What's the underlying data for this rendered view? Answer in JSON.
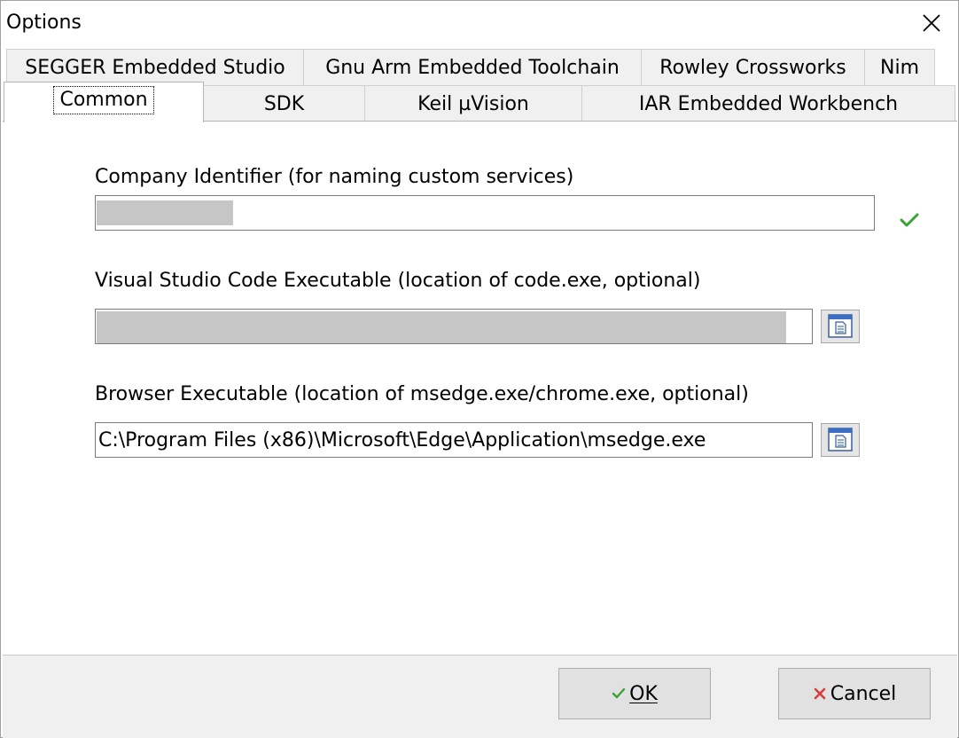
{
  "window": {
    "title": "Options"
  },
  "tabs": {
    "row_top": [
      {
        "label": "SEGGER Embedded Studio"
      },
      {
        "label": "Gnu Arm Embedded Toolchain"
      },
      {
        "label": "Rowley Crossworks"
      },
      {
        "label": "Nim"
      }
    ],
    "row_bottom": [
      {
        "label": "Common",
        "selected": true
      },
      {
        "label": "SDK"
      },
      {
        "label": "Keil µVision"
      },
      {
        "label": "IAR Embedded Workbench"
      }
    ]
  },
  "fields": {
    "company": {
      "label": "Company Identifier (for naming custom services)",
      "value": "",
      "status_icon": "check-icon"
    },
    "vscode": {
      "label": "Visual Studio Code Executable (location of code.exe, optional)",
      "value": "",
      "button_icon": "file-browse-icon"
    },
    "browser": {
      "label": "Browser Executable (location of msedge.exe/chrome.exe, optional)",
      "value": "C:\\Program Files (x86)\\Microsoft\\Edge\\Application\\msedge.exe",
      "button_icon": "file-browse-icon"
    }
  },
  "buttons": {
    "ok_label": "OK",
    "cancel_label": "Cancel"
  },
  "colors": {
    "accent_check": "#3aa335",
    "cancel_x": "#d83b3b",
    "tab_bg": "#f0f0f0",
    "footer_bg": "#f0f0f0"
  }
}
